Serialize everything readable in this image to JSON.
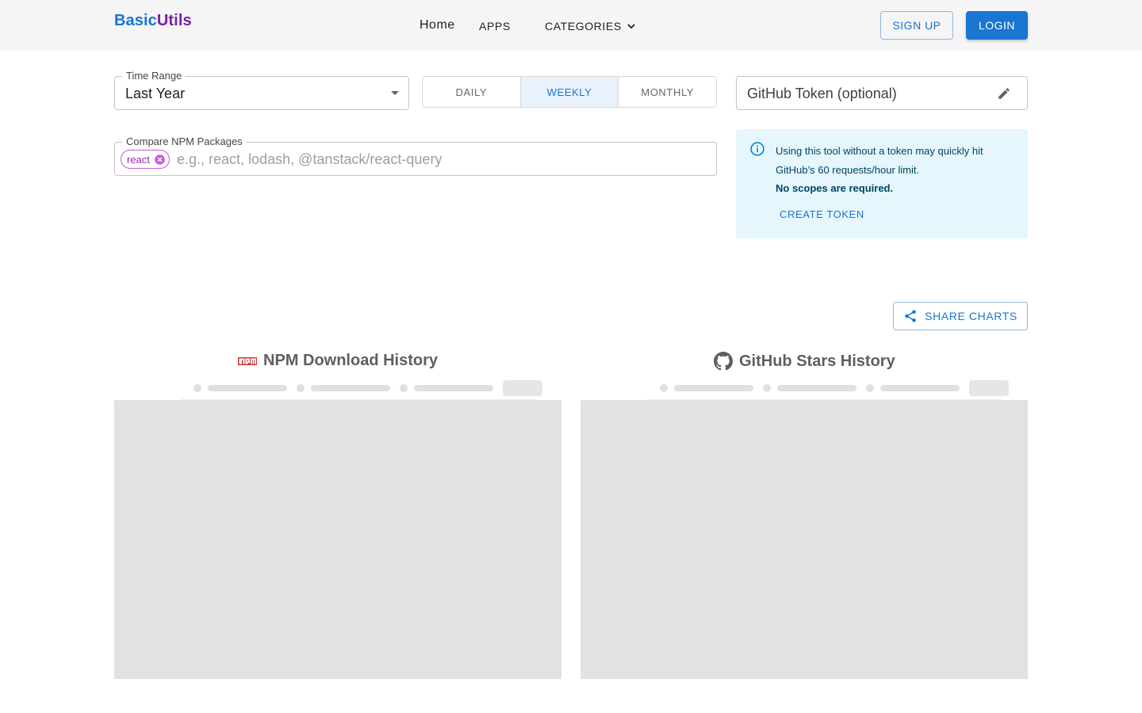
{
  "header": {
    "logo_part1": "Basic",
    "logo_part2": "Utils",
    "nav": {
      "home": "Home",
      "apps": "APPS",
      "categories": "CATEGORIES"
    },
    "signup": "SIGN UP",
    "login": "LOGIN"
  },
  "controls": {
    "time_range": {
      "label": "Time Range",
      "value": "Last Year"
    },
    "interval": {
      "options": [
        "DAILY",
        "WEEKLY",
        "MONTHLY"
      ],
      "selected": "WEEKLY"
    },
    "token": {
      "placeholder": "GitHub Token (optional)"
    },
    "packages": {
      "label": "Compare NPM Packages",
      "chips": [
        "react"
      ],
      "placeholder": "e.g., react, lodash, @tanstack/react-query"
    }
  },
  "alert": {
    "message": "Using this tool without a token may quickly hit GitHub’s 60 requests/hour limit.",
    "bold": "No scopes are required.",
    "action": "CREATE TOKEN"
  },
  "share_button": "SHARE CHARTS",
  "charts": {
    "npm_title": "NPM Download History",
    "github_title": "GitHub Stars History"
  },
  "colors": {
    "primary": "#1976d2",
    "secondary": "#7b1fa2",
    "chip": "#9c27b0",
    "alert_bg": "#e5f6fd",
    "npm_red": "#cb3837"
  },
  "icons": [
    "chevron-down-icon",
    "pencil-icon",
    "cancel-icon",
    "info-icon",
    "share-icon",
    "npm-logo-icon",
    "github-icon"
  ]
}
